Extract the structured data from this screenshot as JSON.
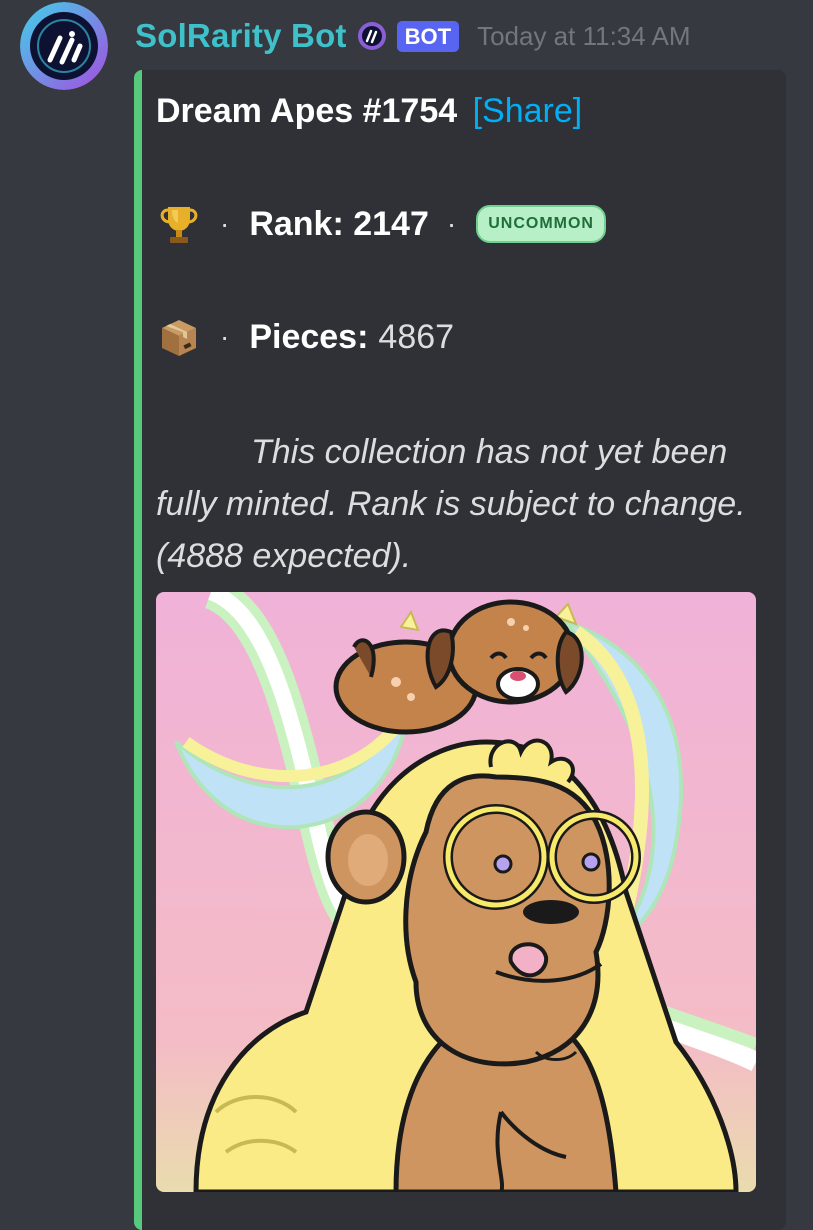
{
  "message": {
    "username": "SolRarity Bot",
    "bot_tag": "BOT",
    "timestamp": "Today at 11:34 AM",
    "avatar_icon": "solrarity-logo",
    "verify_icon": "solrarity-badge-icon"
  },
  "embed": {
    "accent_color": "#57c97c",
    "title": "Dream Apes #1754",
    "share_label": "[Share]",
    "rank": {
      "icon": "trophy-icon",
      "separator": "·",
      "label": "Rank: 2147",
      "separator2": "·",
      "badge": "UNCOMMON"
    },
    "pieces": {
      "icon": "package-icon",
      "separator": "·",
      "label": "Pieces:",
      "value": "4867"
    },
    "note": "This collection has not yet been fully minted. Rank is subject to change. (4888 expected).",
    "image": {
      "subject": "yellow ape with glasses and puppy on head",
      "background": "#f1b4d9"
    }
  }
}
